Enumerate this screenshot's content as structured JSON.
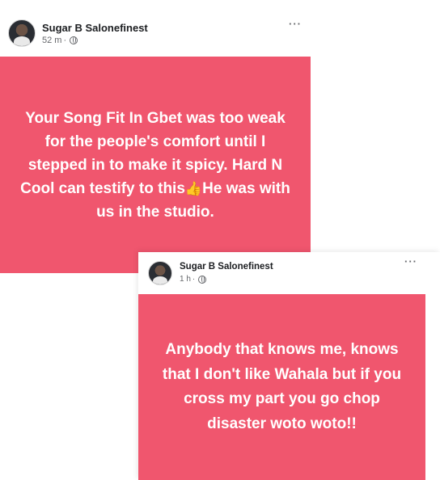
{
  "colors": {
    "post_background": "#f0566e",
    "text_on_post": "#ffffff",
    "name": "#1c1e21",
    "meta": "#65676b"
  },
  "post1": {
    "author": "Sugar B Salonefinest",
    "time": "52 m",
    "separator": "·",
    "privacy_icon": "globe-icon",
    "more_label": "···",
    "text_part1": "Your Song Fit In Gbet was too weak for the people's comfort until I stepped in to make it spicy. Hard N Cool can testify to this",
    "emoji": "👍",
    "text_part2": "He was with us in the studio."
  },
  "post2": {
    "author": "Sugar B Salonefinest",
    "time": "1 h",
    "separator": "·",
    "privacy_icon": "globe-icon",
    "more_label": "···",
    "text": "Anybody that knows me, knows that I don't like Wahala but if you cross my part you go chop disaster woto woto!!"
  }
}
